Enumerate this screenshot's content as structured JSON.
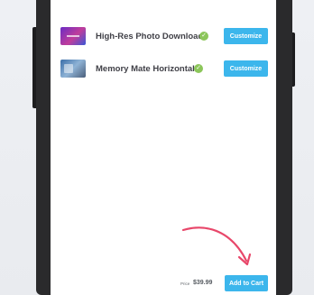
{
  "products": [
    {
      "name": "High-Res Photo Download",
      "thumbnail": "gradient-photo-thumbnail",
      "status_icon": "check-icon",
      "button_label": "Customize"
    },
    {
      "name": "Memory Mate Horizontal",
      "thumbnail": "landscape-photo-thumbnail",
      "status_icon": "check-icon",
      "button_label": "Customize"
    }
  ],
  "footer": {
    "price_label": "Price",
    "price_value": "$39.99",
    "add_to_cart_label": "Add to Cart"
  },
  "annotation": {
    "icon": "red-curved-arrow-icon"
  },
  "colors": {
    "accent": "#3cb6ec",
    "check": "#8cc65a",
    "arrow": "#e8476a",
    "device_frame": "#2a2a2c"
  }
}
